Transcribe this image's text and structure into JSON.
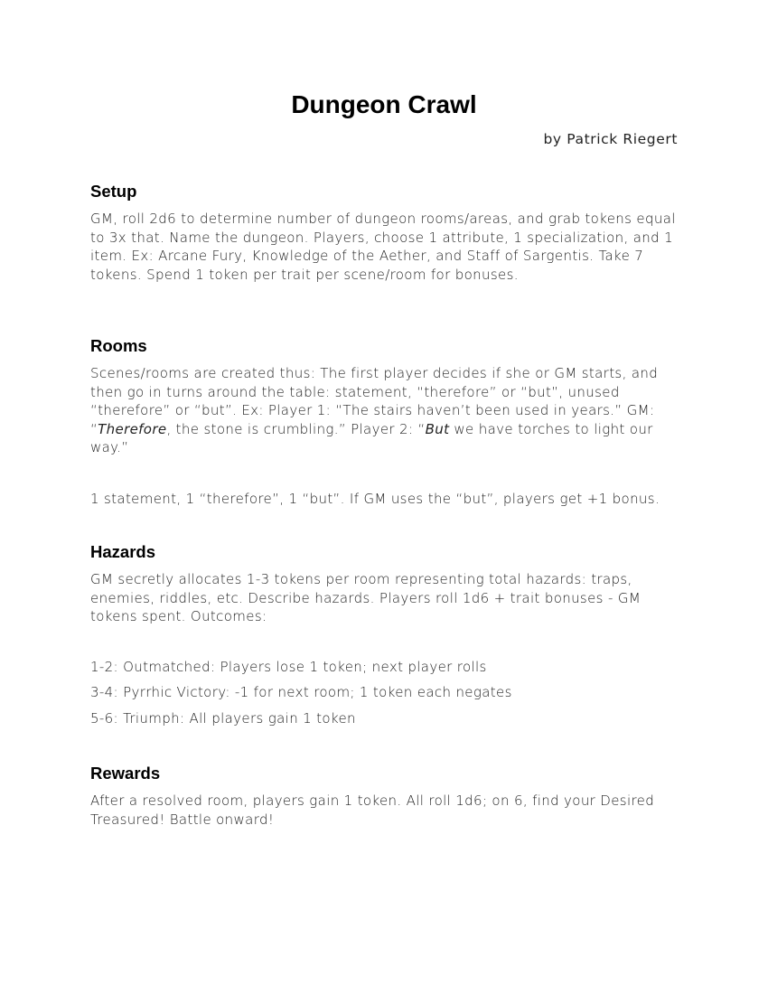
{
  "document": {
    "title": "Dungeon Crawl",
    "author": "by Patrick Riegert"
  },
  "setup": {
    "heading": "Setup",
    "text": "GM, roll 2d6 to determine number of dungeon rooms/areas, and grab tokens equal to 3x that. Name the dungeon. Players, choose 1 attribute, 1 specialization, and 1 item. Ex: Arcane Fury, Knowledge of the Aether, and Staff of Sargentis. Take 7 tokens. Spend 1 token per trait per scene/room for bonuses."
  },
  "rooms": {
    "heading": "Rooms",
    "text_part1": "Scenes/rooms are created thus: The first player decides if she or GM starts, and then go in turns around the table: statement, “therefore” or “but”, unused “therefore” or “but”. Ex: Player 1: “The stairs haven’t been used in years.” GM: “",
    "italic1": "Therefore",
    "text_part2": ", the stone is crumbling.” Player 2: “",
    "italic2": "But",
    "text_part3": " we have torches to light our way.”",
    "rule": "1 statement, 1 “therefore”, 1 “but”. If GM uses the “but”, players get +1 bonus."
  },
  "hazards": {
    "heading": "Hazards",
    "text": "GM secretly allocates 1-3 tokens per room representing total hazards: traps, enemies, riddles, etc. Describe hazards. Players roll 1d6 + trait bonuses - GM tokens spent. Outcomes:",
    "outcomes": [
      "1-2: Outmatched: Players lose 1 token; next player rolls",
      "3-4: Pyrrhic Victory: -1 for next room; 1 token each negates",
      "5-6: Triumph: All players gain 1 token"
    ]
  },
  "rewards": {
    "heading": "Rewards",
    "text": "After a resolved room, players gain 1 token. All roll 1d6; on 6, find your Desired Treasured! Battle onward!"
  }
}
